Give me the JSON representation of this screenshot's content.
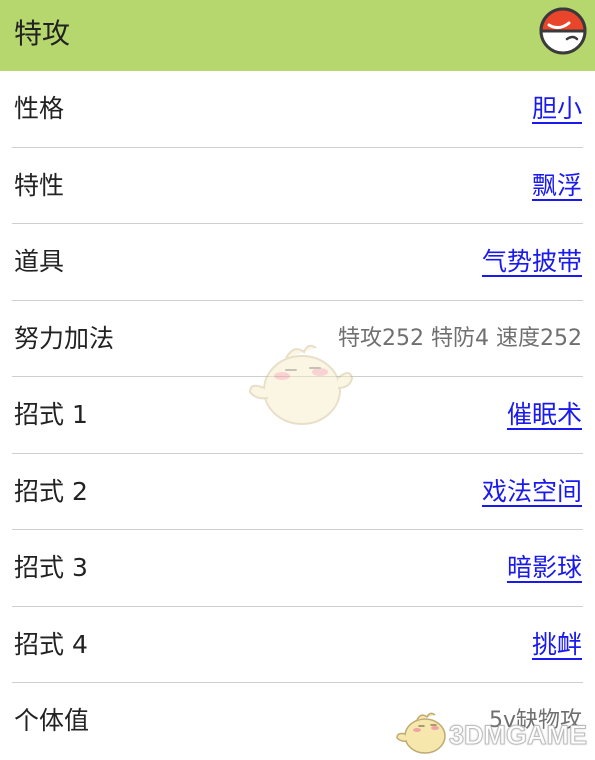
{
  "header": {
    "title": "特攻",
    "icon": "pokeball-icon"
  },
  "rows": [
    {
      "label": "性格",
      "value": "胆小",
      "link": true
    },
    {
      "label": "特性",
      "value": "飘浮",
      "link": true
    },
    {
      "label": "道具",
      "value": "气势披带",
      "link": true
    },
    {
      "label": "努力加法",
      "value": "特攻252 特防4 速度252",
      "link": false
    },
    {
      "label": "招式 1",
      "value": "催眠术",
      "link": true
    },
    {
      "label": "招式 2",
      "value": "戏法空间",
      "link": true
    },
    {
      "label": "招式 3",
      "value": "暗影球",
      "link": true
    },
    {
      "label": "招式 4",
      "value": "挑衅",
      "link": true
    },
    {
      "label": "个体值",
      "value": "5v缺物攻",
      "link": false
    }
  ],
  "watermark": {
    "text": "3DMGAME"
  },
  "colors": {
    "header_bg": "#b6d76e",
    "link": "#1a1aee",
    "divider": "#cfcfcf"
  }
}
